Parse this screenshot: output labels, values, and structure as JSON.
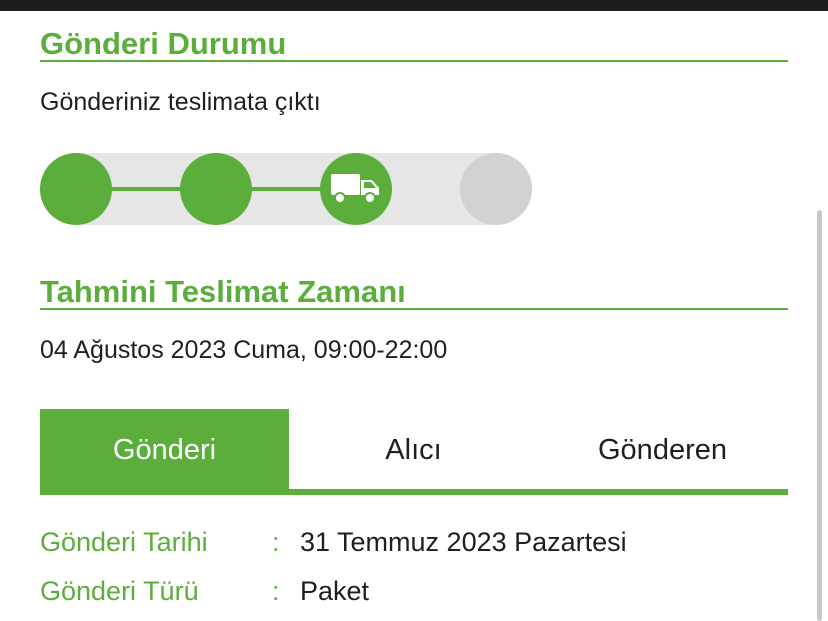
{
  "status_section": {
    "title": "Gönderi Durumu",
    "status_text": "Gönderiniz teslimata çıktı",
    "steps_completed": 2,
    "current_step": 3,
    "total_steps": 4,
    "current_step_icon": "delivery-truck-icon"
  },
  "eta_section": {
    "title": "Tahmini Teslimat Zamanı",
    "eta": "04 Ağustos 2023 Cuma, 09:00-22:00"
  },
  "tabs": [
    {
      "label": "Gönderi",
      "active": true
    },
    {
      "label": "Alıcı",
      "active": false
    },
    {
      "label": "Gönderen",
      "active": false
    }
  ],
  "shipment_details": [
    {
      "label": "Gönderi Tarihi",
      "separator": ":",
      "value": "31 Temmuz 2023 Pazartesi"
    },
    {
      "label": "Gönderi Türü",
      "separator": ":",
      "value": "Paket"
    }
  ],
  "colors": {
    "accent": "#5cae3c",
    "pending_step": "#d2d2d2",
    "track": "#e6e6e6"
  }
}
